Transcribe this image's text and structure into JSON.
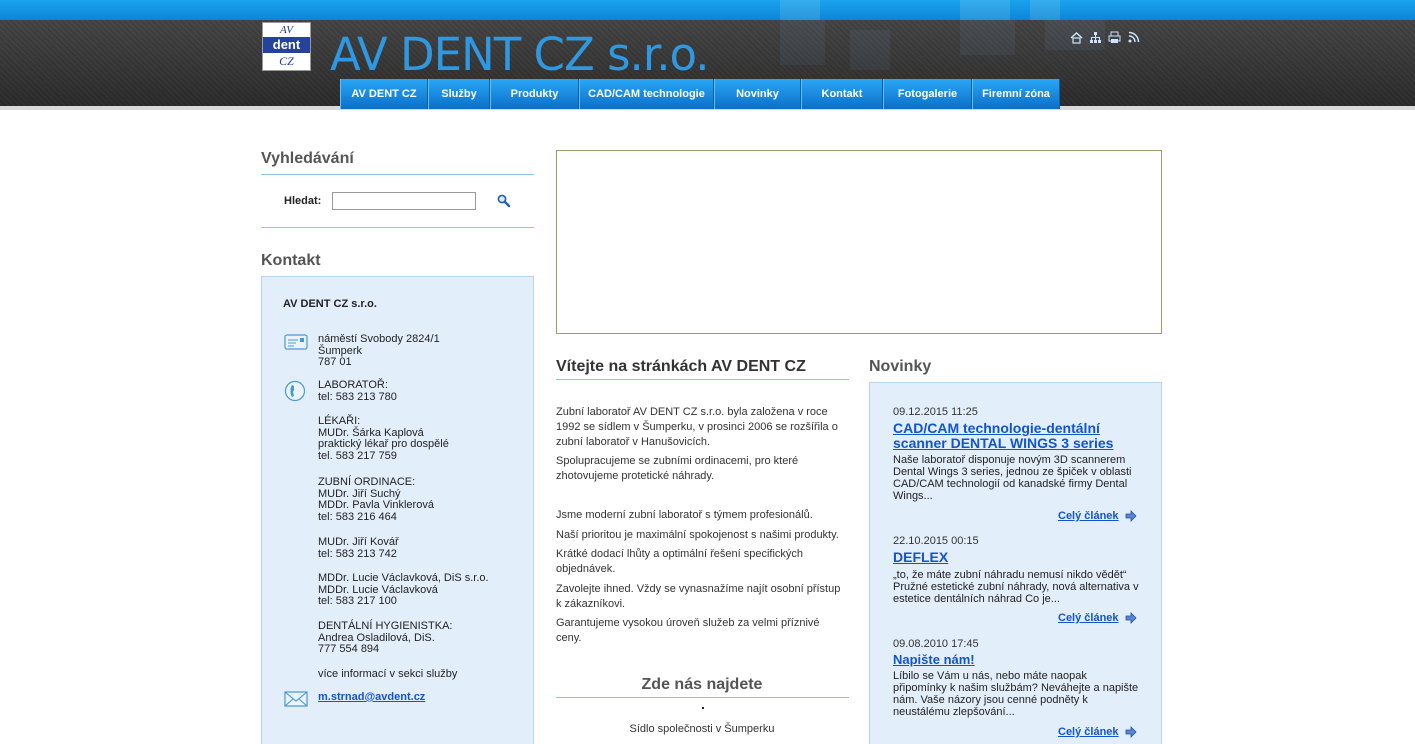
{
  "header": {
    "site_title": "AV DENT CZ s.r.o.",
    "logo": {
      "line1": "AV",
      "line2": "dent",
      "line3": "CZ"
    },
    "tool_icons": [
      "home-icon",
      "sitemap-icon",
      "print-icon",
      "rss-icon"
    ]
  },
  "nav": {
    "items": [
      {
        "label": "AV DENT CZ"
      },
      {
        "label": "Služby"
      },
      {
        "label": "Produkty"
      },
      {
        "label": "CAD/CAM technologie"
      },
      {
        "label": "Novinky"
      },
      {
        "label": "Kontakt"
      },
      {
        "label": "Fotogalerie"
      },
      {
        "label": "Firemní zóna"
      }
    ]
  },
  "search": {
    "heading": "Vyhledávání",
    "label": "Hledat:",
    "value": "",
    "placeholder": ""
  },
  "contact": {
    "heading": "Kontakt",
    "company": "AV DENT CZ s.r.o.",
    "address": "náměstí Svobody 2824/1\nŠumperk\n787 01",
    "lab": "LABORATOŘ:\ntel: 583 213 780",
    "doctors": "LÉKAŘI:\nMUDr. Šárka Kaplová\npraktický lékař pro dospělé\ntel. 583 217 759",
    "dental": "ZUBNÍ ORDINACE:\nMUDr. Jiří Suchý\nMDDr. Pavla Vinklerová\ntel: 583 216 464",
    "kovar": "MUDr. Jiří Kovář\ntel: 583 213 742",
    "vaclavkova": "MDDr. Lucie Václavková, DiS s.r.o.\nMDDr. Lucie Václavková\ntel: 583 217 100",
    "hygiene": "DENTÁLNÍ HYGIENISTKA:\nAndrea Osladilová, DiS.\n777 554 894",
    "more": "více informací v sekci služby",
    "email": "m.strnad@avdent.cz"
  },
  "welcome": {
    "title": "Vítejte na stránkách AV DENT CZ",
    "p1": "Zubní laboratoř AV DENT CZ s.r.o. byla založena v roce 1992 se sídlem v Šumperku, v prosinci 2006 se rozšířila o zubní laboratoř v Hanušovicích.",
    "p2": "Spolupracujeme se zubními ordinacemi, pro které zhotovujeme protetické náhrady.",
    "p3": "Jsme moderní zubní laboratoř s týmem profesionálů.",
    "p4": "Naší prioritou je maximální spokojenost s našimi produkty.",
    "p5": "Krátké dodací lhůty a optimální řešení specifických objednávek.",
    "p6": "Zavolejte ihned. Vždy se vynasnažíme najít osobní přístup k zákazníkovi.",
    "p7": "Garantujeme vysokou úroveň služeb za velmi příznivé ceny."
  },
  "find": {
    "title": "Zde nás najdete",
    "caption": "Sídlo společnosti v Šumperku"
  },
  "news": {
    "heading": "Novinky",
    "items": [
      {
        "date": "09.12.2015 11:25",
        "title": "CAD/CAM technologie-dentální scanner DENTAL WINGS 3 series",
        "text": "Naše laboratoř disponuje novým 3D scannerem Dental Wings 3 series, jednou ze špiček v oblasti CAD/CAM technologií od kanadské firmy Dental Wings...",
        "more": "Celý článek"
      },
      {
        "date": "22.10.2015 00:15",
        "title": "DEFLEX",
        "text": "„to, že máte zubní náhradu nemusí nikdo vědět“ Pružné estetické zubní náhrady, nová alternativa v estetice dentálních náhrad   Co je...",
        "more": "Celý článek"
      },
      {
        "date": "09.08.2010 17:45",
        "title": "Napište nám!",
        "text": "Líbilo se Vám u nás, nebo máte naopak připomínky k našim službám? Neváhejte a napište nám. Vaše názory jsou cenné podněty k neustálému zlepšování...",
        "more": "Celý článek"
      }
    ]
  }
}
